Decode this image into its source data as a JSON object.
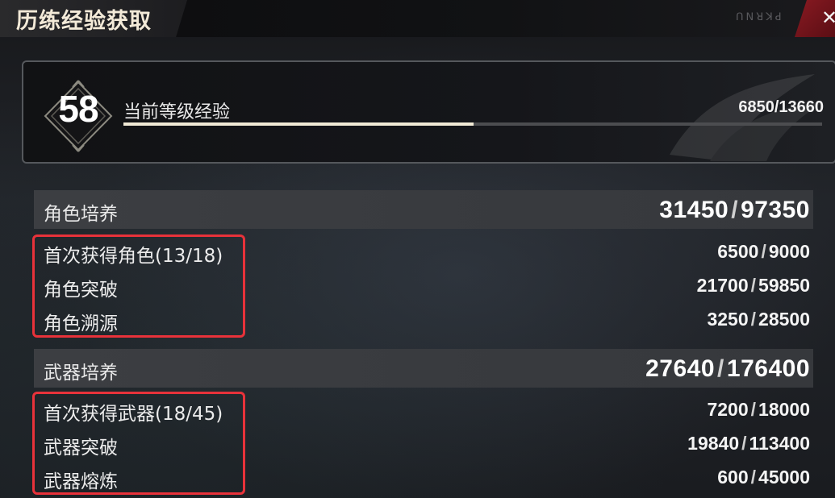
{
  "window": {
    "title": "历练经验获取",
    "deco_text": "ꓵꓠꓤꓘꓒ"
  },
  "level": {
    "number": "58",
    "label": "当前等级经验",
    "current": "6850",
    "max": "13660",
    "display": "6850/13660",
    "progress_fraction": 0.5015
  },
  "sections": [
    {
      "title": "角色培养",
      "current": "31450",
      "max": "97350",
      "rows": [
        {
          "label": "首次获得角色(13/18)",
          "current": "6500",
          "max": "9000"
        },
        {
          "label": "角色突破",
          "current": "21700",
          "max": "59850"
        },
        {
          "label": "角色溯源",
          "current": "3250",
          "max": "28500"
        }
      ]
    },
    {
      "title": "武器培养",
      "current": "27640",
      "max": "176400",
      "rows": [
        {
          "label": "首次获得武器(18/45)",
          "current": "7200",
          "max": "18000"
        },
        {
          "label": "武器突破",
          "current": "19840",
          "max": "113400"
        },
        {
          "label": "武器熔炼",
          "current": "600",
          "max": "45000"
        }
      ]
    }
  ],
  "separator": "/",
  "colors": {
    "accent": "#e8323a",
    "close_bg": "#7a161e",
    "progress": "#f1ead6"
  }
}
